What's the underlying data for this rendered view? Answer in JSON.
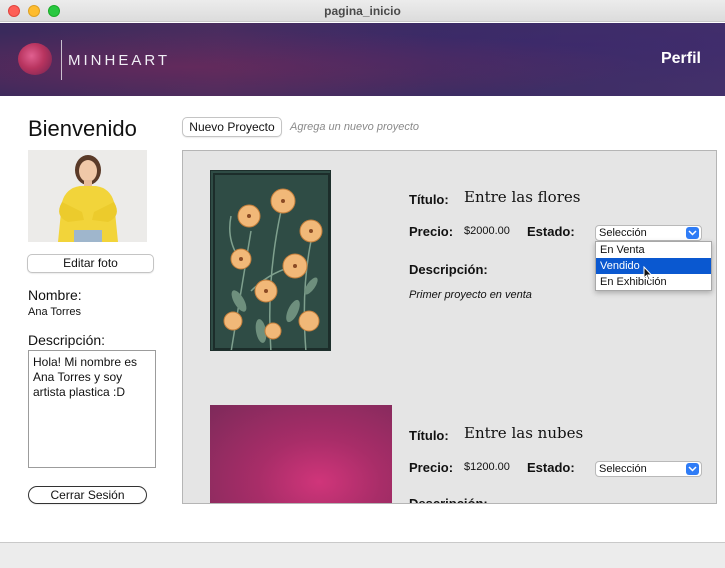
{
  "window": {
    "title": "pagina_inicio"
  },
  "header": {
    "brand": "MINHEART",
    "profile_link": "Perfil"
  },
  "profile": {
    "welcome": "Bienvenido",
    "edit_photo_label": "Editar foto",
    "name_label": "Nombre:",
    "name_value": "Ana Torres",
    "description_label": "Descripción:",
    "description_value": "Hola! Mi nombre es Ana Torres y soy artista plastica :D",
    "logout_label": "Cerrar Sesión"
  },
  "toolbar": {
    "new_project_label": "Nuevo Proyecto",
    "new_project_hint": "Agrega un nuevo proyecto"
  },
  "projects": [
    {
      "title_label": "Título:",
      "title": "Entre las flores",
      "price_label": "Precio:",
      "price": "$2000.00",
      "status_label": "Estado:",
      "status_selected": "Selección",
      "description_label": "Descripción:",
      "description": "Primer proyecto en venta",
      "dropdown_open": true,
      "status_options": [
        "En Venta",
        "Vendido",
        "En Exhibición"
      ],
      "highlighted_option": "Vendido"
    },
    {
      "title_label": "Título:",
      "title": "Entre las nubes",
      "price_label": "Precio:",
      "price": "$1200.00",
      "status_label": "Estado:",
      "status_selected": "Selección",
      "description_label": "Descripción:"
    }
  ],
  "colors": {
    "banner": "#3b2c63",
    "accent_blue": "#2f7cf6",
    "selection_blue": "#0a58d0",
    "panel_bg": "#e5e5e5"
  }
}
